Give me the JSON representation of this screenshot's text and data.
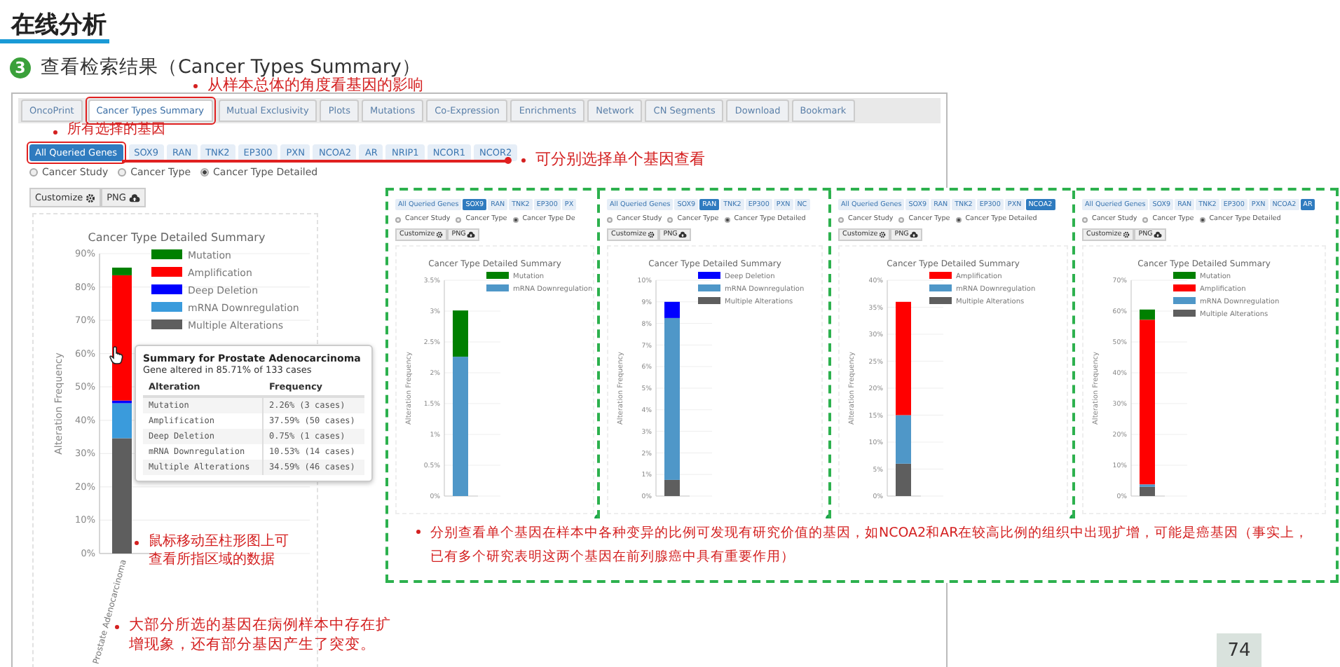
{
  "slide": {
    "title": "在线分析",
    "step_number": "3",
    "step_title": "查看检索结果（Cancer Types Summary）",
    "page_number": "74"
  },
  "portal": {
    "tabs": [
      {
        "label": "OncoPrint",
        "selected": false
      },
      {
        "label": "Cancer Types Summary",
        "selected": true
      },
      {
        "label": "Mutual Exclusivity",
        "selected": false
      },
      {
        "label": "Plots",
        "selected": false
      },
      {
        "label": "Mutations",
        "selected": false
      },
      {
        "label": "Co-Expression",
        "selected": false
      },
      {
        "label": "Enrichments",
        "selected": false
      },
      {
        "label": "Network",
        "selected": false
      },
      {
        "label": "CN Segments",
        "selected": false
      },
      {
        "label": "Download",
        "selected": false
      },
      {
        "label": "Bookmark",
        "selected": false
      }
    ],
    "genes": [
      {
        "label": "All Queried Genes",
        "selected": true
      },
      {
        "label": "SOX9",
        "selected": false
      },
      {
        "label": "RAN",
        "selected": false
      },
      {
        "label": "TNK2",
        "selected": false
      },
      {
        "label": "EP300",
        "selected": false
      },
      {
        "label": "PXN",
        "selected": false
      },
      {
        "label": "NCOA2",
        "selected": false
      },
      {
        "label": "AR",
        "selected": false
      },
      {
        "label": "NRIP1",
        "selected": false
      },
      {
        "label": "NCOR1",
        "selected": false
      },
      {
        "label": "NCOR2",
        "selected": false
      }
    ],
    "radios": [
      {
        "label": "Cancer Study",
        "selected": false
      },
      {
        "label": "Cancer Type",
        "selected": false
      },
      {
        "label": "Cancer Type Detailed",
        "selected": true
      }
    ],
    "buttons": [
      "Customize",
      "PNG"
    ],
    "chart_data": {
      "type": "bar",
      "title": "Cancer Type Detailed Summary",
      "ylabel": "Alteration Frequency",
      "categories": [
        "Prostate Adenocarcinoma"
      ],
      "stacked": true,
      "grid": true,
      "legend": true,
      "ylim": [
        0,
        90
      ],
      "yticks": [
        {
          "value": 0,
          "label": "0%"
        },
        {
          "value": 10,
          "label": "10%"
        },
        {
          "value": 20,
          "label": "20%"
        },
        {
          "value": 30,
          "label": "30%"
        },
        {
          "value": 40,
          "label": "40%"
        },
        {
          "value": 50,
          "label": "50%"
        },
        {
          "value": 60,
          "label": "60%"
        },
        {
          "value": 70,
          "label": "70%"
        },
        {
          "value": 80,
          "label": "80%"
        },
        {
          "value": 90,
          "label": "90%"
        }
      ],
      "series": [
        {
          "name": "Mutation",
          "color": "#008000",
          "values": [
            2.3
          ]
        },
        {
          "name": "Amplification",
          "color": "#ff0000",
          "values": [
            37.6
          ]
        },
        {
          "name": "Deep Deletion",
          "color": "#0000ff",
          "values": [
            0.8
          ]
        },
        {
          "name": "mRNA Downregulation",
          "color": "#3a9bdc",
          "values": [
            10.5
          ]
        },
        {
          "name": "Multiple Alterations",
          "color": "#5e5e5e",
          "values": [
            34.6
          ]
        }
      ]
    },
    "tooltip": {
      "title": "Summary for Prostate Adenocarcinoma",
      "subtitle": "Gene altered in 85.71% of 133 cases",
      "columns": [
        "Alteration",
        "Frequency"
      ],
      "rows": [
        [
          "Mutation",
          "2.26% (3 cases)"
        ],
        [
          "Amplification",
          "37.59% (50 cases)"
        ],
        [
          "Deep Deletion",
          "0.75% (1 cases)"
        ],
        [
          "mRNA Downregulation",
          "10.53% (14 cases)"
        ],
        [
          "Multiple Alterations",
          "34.59% (46 cases)"
        ]
      ]
    }
  },
  "gene_panels": [
    {
      "genes": [
        {
          "label": "All Queried Genes",
          "selected": false
        },
        {
          "label": "SOX9",
          "selected": true
        },
        {
          "label": "RAN",
          "selected": false
        },
        {
          "label": "TNK2",
          "selected": false
        },
        {
          "label": "EP300",
          "selected": false
        },
        {
          "label": "PX",
          "selected": false
        }
      ],
      "radios": [
        {
          "label": "Cancer Study",
          "selected": false
        },
        {
          "label": "Cancer Type",
          "selected": false
        },
        {
          "label": "Cancer Type De",
          "selected": true
        }
      ],
      "buttons": [
        "Customize",
        "PNG"
      ],
      "chart_data": {
        "type": "bar",
        "title": "Cancer Type Detailed Summary",
        "ylabel": "Alteration Frequency",
        "stacked": true,
        "grid": true,
        "legend": true,
        "ylim": [
          0,
          3.5
        ],
        "yticks": [
          {
            "value": 0,
            "label": "0%"
          },
          {
            "value": 0.5,
            "label": "0.5%"
          },
          {
            "value": 1,
            "label": "1%"
          },
          {
            "value": 1.5,
            "label": "1.5%"
          },
          {
            "value": 2,
            "label": "2%"
          },
          {
            "value": 2.5,
            "label": "2.5%"
          },
          {
            "value": 3,
            "label": "3%"
          },
          {
            "value": 3.5,
            "label": "3.5%"
          }
        ],
        "series": [
          {
            "name": "Mutation",
            "color": "#008000",
            "values": [
              0.75
            ]
          },
          {
            "name": "mRNA Downregulation",
            "color": "#4f97c8",
            "values": [
              2.26
            ]
          }
        ]
      }
    },
    {
      "genes": [
        {
          "label": "All Queried Genes",
          "selected": false
        },
        {
          "label": "SOX9",
          "selected": false
        },
        {
          "label": "RAN",
          "selected": true
        },
        {
          "label": "TNK2",
          "selected": false
        },
        {
          "label": "EP300",
          "selected": false
        },
        {
          "label": "PXN",
          "selected": false
        },
        {
          "label": "NC",
          "selected": false
        }
      ],
      "radios": [
        {
          "label": "Cancer Study",
          "selected": false
        },
        {
          "label": "Cancer Type",
          "selected": false
        },
        {
          "label": "Cancer Type Detailed",
          "selected": true
        }
      ],
      "buttons": [
        "Customize",
        "PNG"
      ],
      "chart_data": {
        "type": "bar",
        "title": "Cancer Type Detailed Summary",
        "ylabel": "Alteration Frequency",
        "stacked": true,
        "grid": true,
        "legend": true,
        "ylim": [
          0,
          10
        ],
        "yticks": [
          {
            "value": 0,
            "label": "0%"
          },
          {
            "value": 1,
            "label": "1%"
          },
          {
            "value": 2,
            "label": "2%"
          },
          {
            "value": 3,
            "label": "3%"
          },
          {
            "value": 4,
            "label": "4%"
          },
          {
            "value": 5,
            "label": "5%"
          },
          {
            "value": 6,
            "label": "6%"
          },
          {
            "value": 7,
            "label": "7%"
          },
          {
            "value": 8,
            "label": "8%"
          },
          {
            "value": 9,
            "label": "9%"
          },
          {
            "value": 10,
            "label": "10%"
          }
        ],
        "series": [
          {
            "name": "Deep Deletion",
            "color": "#0000ff",
            "values": [
              0.75
            ]
          },
          {
            "name": "mRNA Downregulation",
            "color": "#4f97c8",
            "values": [
              7.5
            ]
          },
          {
            "name": "Multiple Alterations",
            "color": "#5e5e5e",
            "values": [
              0.75
            ]
          }
        ]
      }
    },
    {
      "genes": [
        {
          "label": "All Queried Genes",
          "selected": false
        },
        {
          "label": "SOX9",
          "selected": false
        },
        {
          "label": "RAN",
          "selected": false
        },
        {
          "label": "TNK2",
          "selected": false
        },
        {
          "label": "EP300",
          "selected": false
        },
        {
          "label": "PXN",
          "selected": false
        },
        {
          "label": "NCOA2",
          "selected": true
        }
      ],
      "radios": [
        {
          "label": "Cancer Study",
          "selected": false
        },
        {
          "label": "Cancer Type",
          "selected": false
        },
        {
          "label": "Cancer Type Detailed",
          "selected": true
        }
      ],
      "buttons": [
        "Customize",
        "PNG"
      ],
      "chart_data": {
        "type": "bar",
        "title": "Cancer Type Detailed Summary",
        "ylabel": "Alteration Frequency",
        "stacked": true,
        "grid": true,
        "legend": true,
        "ylim": [
          0,
          40
        ],
        "yticks": [
          {
            "value": 0,
            "label": "0%"
          },
          {
            "value": 5,
            "label": "5%"
          },
          {
            "value": 10,
            "label": "10%"
          },
          {
            "value": 15,
            "label": "15%"
          },
          {
            "value": 20,
            "label": "20%"
          },
          {
            "value": 25,
            "label": "25%"
          },
          {
            "value": 30,
            "label": "30%"
          },
          {
            "value": 35,
            "label": "35%"
          },
          {
            "value": 40,
            "label": "40%"
          }
        ],
        "series": [
          {
            "name": "Amplification",
            "color": "#ff0000",
            "values": [
              21
            ]
          },
          {
            "name": "mRNA Downregulation",
            "color": "#4f97c8",
            "values": [
              9
            ]
          },
          {
            "name": "Multiple Alterations",
            "color": "#5e5e5e",
            "values": [
              6
            ]
          }
        ]
      }
    },
    {
      "genes": [
        {
          "label": "All Queried Genes",
          "selected": false
        },
        {
          "label": "SOX9",
          "selected": false
        },
        {
          "label": "RAN",
          "selected": false
        },
        {
          "label": "TNK2",
          "selected": false
        },
        {
          "label": "EP300",
          "selected": false
        },
        {
          "label": "PXN",
          "selected": false
        },
        {
          "label": "NCOA2",
          "selected": false
        },
        {
          "label": "AR",
          "selected": true
        }
      ],
      "radios": [
        {
          "label": "Cancer Study",
          "selected": false
        },
        {
          "label": "Cancer Type",
          "selected": false
        },
        {
          "label": "Cancer Type Detailed",
          "selected": true
        }
      ],
      "buttons": [
        "Customize",
        "PNG"
      ],
      "chart_data": {
        "type": "bar",
        "title": "Cancer Type Detailed Summary",
        "ylabel": "Alteration Frequency",
        "stacked": true,
        "grid": true,
        "legend": true,
        "ylim": [
          0,
          70
        ],
        "yticks": [
          {
            "value": 0,
            "label": "0%"
          },
          {
            "value": 10,
            "label": "10%"
          },
          {
            "value": 20,
            "label": "20%"
          },
          {
            "value": 30,
            "label": "30%"
          },
          {
            "value": 40,
            "label": "40%"
          },
          {
            "value": 50,
            "label": "50%"
          },
          {
            "value": 60,
            "label": "60%"
          },
          {
            "value": 70,
            "label": "70%"
          }
        ],
        "series": [
          {
            "name": "Mutation",
            "color": "#008000",
            "values": [
              3.3
            ]
          },
          {
            "name": "Amplification",
            "color": "#ff0000",
            "values": [
              53.4
            ]
          },
          {
            "name": "mRNA Downregulation",
            "color": "#4f97c8",
            "values": [
              0.8
            ]
          },
          {
            "name": "Multiple Alterations",
            "color": "#5e5e5e",
            "values": [
              3
            ]
          }
        ]
      }
    }
  ],
  "annotations": [
    {
      "text": "从样本总体的角度看基因的影响"
    },
    {
      "text": "所有选择的基因"
    },
    {
      "text": "可分别选择单个基因查看"
    },
    {
      "text": "鼠标移动至柱形图上可查看所指区域的数据"
    },
    {
      "text": "大部分所选的基因在病例样本中存在扩增现象，还有部分基因产生了突变。"
    },
    {
      "text": "分别查看单个基因在样本中各种变异的比例可发现有研究价值的基因，如NCOA2和AR在较高比例的组织中出现扩增，可能是癌基因（事实上，已有多个研究表明这两个基因在前列腺癌中具有重要作用）"
    }
  ]
}
